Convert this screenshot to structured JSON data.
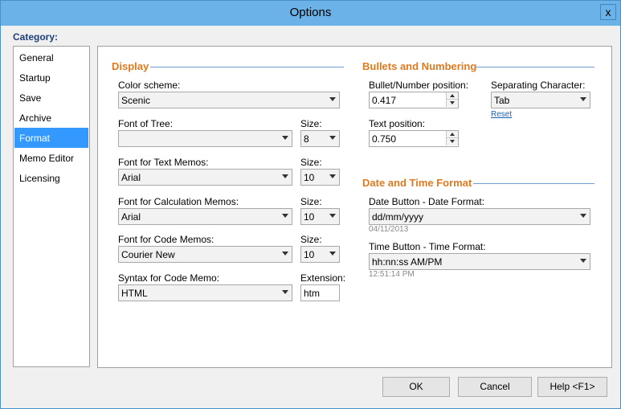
{
  "window": {
    "title": "Options",
    "close_glyph": "x"
  },
  "category": {
    "label": "Category:",
    "items": [
      "General",
      "Startup",
      "Save",
      "Archive",
      "Format",
      "Memo Editor",
      "Licensing"
    ],
    "selected": "Format"
  },
  "display": {
    "heading": "Display",
    "color_scheme": {
      "label": "Color scheme:",
      "value": "Scenic"
    },
    "font_of_tree": {
      "label": "Font of Tree:",
      "value": "",
      "size_label": "Size:",
      "size": "8"
    },
    "font_text": {
      "label": "Font for Text Memos:",
      "value": "Arial",
      "size_label": "Size:",
      "size": "10"
    },
    "font_calc": {
      "label": "Font for Calculation Memos:",
      "value": "Arial",
      "size_label": "Size:",
      "size": "10"
    },
    "font_code": {
      "label": "Font for Code Memos:",
      "value": "Courier New",
      "size_label": "Size:",
      "size": "10"
    },
    "syntax": {
      "label": "Syntax for Code Memo:",
      "value": "HTML",
      "ext_label": "Extension:",
      "ext": "htm"
    }
  },
  "bullets": {
    "heading": "Bullets and Numbering",
    "bullet_pos": {
      "label": "Bullet/Number position:",
      "value": "0.417"
    },
    "text_pos": {
      "label": "Text position:",
      "value": "0.750"
    },
    "sep_char": {
      "label": "Separating Character:",
      "value": "Tab",
      "reset": "Reset"
    }
  },
  "datetime": {
    "heading": "Date and Time Format",
    "date_fmt": {
      "label": "Date Button - Date Format:",
      "value": "dd/mm/yyyy",
      "preview": "04/11/2013"
    },
    "time_fmt": {
      "label": "Time Button - Time Format:",
      "value": "hh:nn:ss AM/PM",
      "preview": "12:51:14 PM"
    }
  },
  "buttons": {
    "ok": "OK",
    "cancel": "Cancel",
    "help": "Help <F1>"
  },
  "colors": {
    "titlebar": "#6ab2e8",
    "selection": "#3399ff",
    "section_heading": "#e07a20",
    "category_label": "#1e3f7a"
  }
}
